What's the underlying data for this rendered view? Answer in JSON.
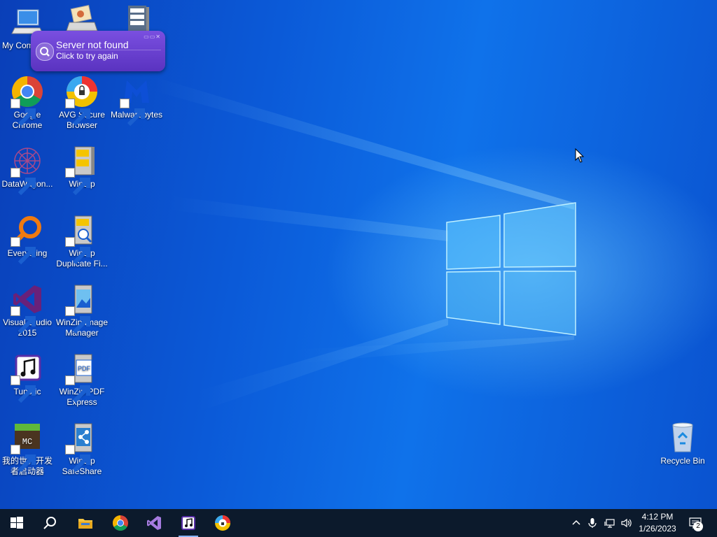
{
  "desktop": {
    "icons": [
      {
        "label": "My Computer",
        "icon": "computer-icon"
      },
      {
        "label": "",
        "icon": "photo-scanner-icon"
      },
      {
        "label": "",
        "icon": "server-cabinet-icon"
      },
      {
        "label": "Google Chrome",
        "icon": "chrome-icon"
      },
      {
        "label": "AVG Secure Browser",
        "icon": "avg-browser-icon"
      },
      {
        "label": "Malwarebytes",
        "icon": "malwarebytes-icon"
      },
      {
        "label": "DataWagon...",
        "icon": "datawagon-icon"
      },
      {
        "label": "WinZip",
        "icon": "winzip-icon"
      },
      {
        "label": "Everything",
        "icon": "everything-icon"
      },
      {
        "label": "WinZip Duplicate Fi...",
        "icon": "winzip-duplicate-icon"
      },
      {
        "label": "Visual Studio 2015",
        "icon": "visual-studio-icon"
      },
      {
        "label": "WinZip Image Manager",
        "icon": "winzip-image-icon"
      },
      {
        "label": "Tunatic",
        "icon": "tunatic-icon"
      },
      {
        "label": "WinZip PDF Express",
        "icon": "winzip-pdf-icon"
      },
      {
        "label": "我的世界开发者启动器",
        "icon": "minecraft-launcher-icon"
      },
      {
        "label": "WinZip SafeShare",
        "icon": "winzip-safeshare-icon"
      },
      {
        "label": "Recycle Bin",
        "icon": "recycle-bin-icon"
      }
    ]
  },
  "toast": {
    "title": "Server not found",
    "subtitle": "Click to try again",
    "icon": "search-icon"
  },
  "taskbar": {
    "apps": [
      "start-icon",
      "search-icon",
      "file-explorer-icon",
      "chrome-icon",
      "visual-studio-icon",
      "tunatic-icon",
      "avg-browser-icon"
    ],
    "tray": [
      "chevron-up-icon",
      "microphone-icon",
      "network-icon",
      "volume-icon"
    ],
    "clock": {
      "time": "4:12 PM",
      "date": "1/26/2023"
    },
    "notifications": {
      "count": "2"
    }
  },
  "colors": {
    "taskbar": "#0c1a2c",
    "toast": "#6a42d0",
    "desktop": "#0b5ad8"
  }
}
